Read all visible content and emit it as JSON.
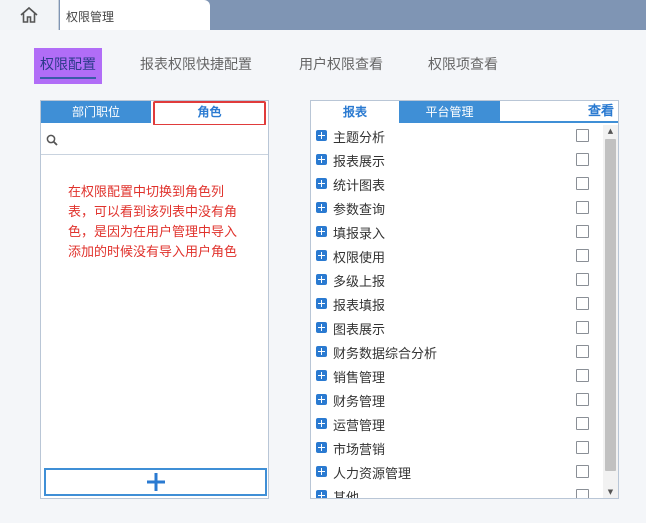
{
  "tabbar": {
    "home_icon": "home-icon",
    "document_tab": "权限管理"
  },
  "subtabs": [
    {
      "label": "权限配置",
      "active": true
    },
    {
      "label": "报表权限快捷配置",
      "active": false
    },
    {
      "label": "用户权限查看",
      "active": false
    },
    {
      "label": "权限项查看",
      "active": false
    }
  ],
  "left_panel": {
    "tabs": [
      "部门职位",
      "角色"
    ],
    "search_icon": "search-icon",
    "annotation": "在权限配置中切换到角色列表，可以看到该列表中没有角色，是因为在用户管理中导入添加的时候没有导入用户角色",
    "add_icon": "plus-icon"
  },
  "right_panel": {
    "tabs": [
      "报表",
      "平台管理"
    ],
    "view_link": "查看",
    "items": [
      "主题分析",
      "报表展示",
      "统计图表",
      "参数查询",
      "填报录入",
      "权限使用",
      "多级上报",
      "报表填报",
      "图表展示",
      "财务数据综合分析",
      "销售管理",
      "财务管理",
      "运营管理",
      "市场营销",
      "人力资源管理",
      "其他"
    ]
  },
  "colors": {
    "accent": "#3f8fd6",
    "active_subtab_bg": "#b16df7",
    "annotation_red": "#e0322c",
    "topbar": "#7f95b4"
  }
}
